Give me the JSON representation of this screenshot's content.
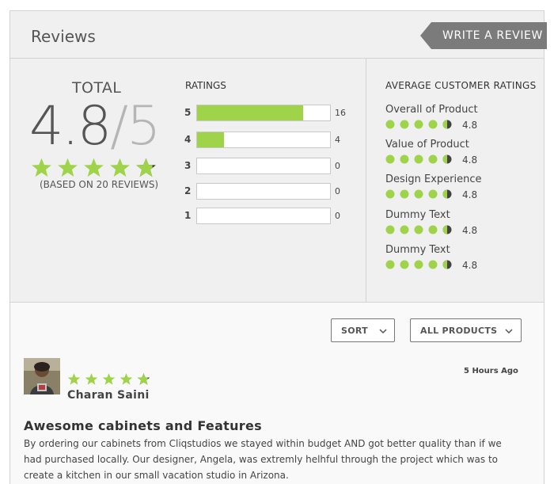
{
  "header": {
    "title": "Reviews",
    "write_button": "WRITE A REVIEW"
  },
  "summary": {
    "total_label": "TOTAL",
    "score": "4.8",
    "score_max": "/5",
    "stars_value": 4.8,
    "based_on": "(BASED ON 20 REVIEWS)"
  },
  "ratings": {
    "label": "RATINGS",
    "rows": [
      {
        "stars": "5",
        "count": "16",
        "fraction": 0.8
      },
      {
        "stars": "4",
        "count": "4",
        "fraction": 0.2
      },
      {
        "stars": "3",
        "count": "0",
        "fraction": 0
      },
      {
        "stars": "2",
        "count": "0",
        "fraction": 0
      },
      {
        "stars": "1",
        "count": "0",
        "fraction": 0
      }
    ]
  },
  "average": {
    "label": "AVERAGE CUSTOMER RATINGS",
    "criteria": [
      {
        "name": "Overall of Product",
        "value": "4.8"
      },
      {
        "name": "Value of Product",
        "value": "4.8"
      },
      {
        "name": "Design Experience",
        "value": "4.8"
      },
      {
        "name": "Dummy Text",
        "value": "4.8"
      },
      {
        "name": "Dummy Text",
        "value": "4.8"
      }
    ]
  },
  "filters": {
    "sort_label": "SORT",
    "products_label": "ALL PRODUCTS"
  },
  "review": {
    "reviewer": "Charan Saini",
    "time": "5 Hours Ago",
    "stars_value": 4.8,
    "title": "Awesome cabinets and Features",
    "body": "By ordering our cabinets from Cliqstudios we stayed within budget AND got better quality than if we had purchased locally. Our designer, Angela, was extremly helhful through the project which was to create a kitchen in our small vacation studio in Arizona."
  },
  "colors": {
    "accent_green": "#9fd44a",
    "button_gray": "#777777"
  },
  "icons": {
    "star": "star-icon",
    "dot": "rating-dot-icon",
    "chevron": "chevron-down-icon"
  }
}
